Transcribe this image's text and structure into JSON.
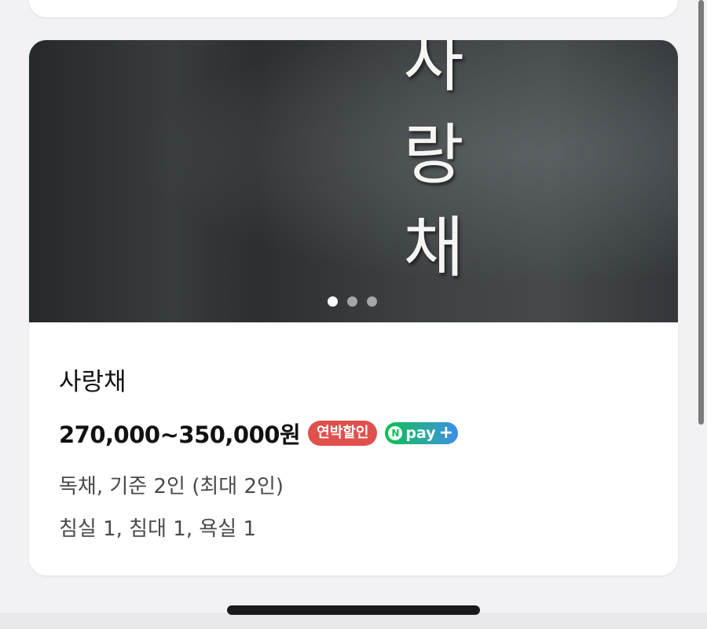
{
  "listing": {
    "photo_sign_chars": [
      "사",
      "랑",
      "채"
    ],
    "carousel": {
      "total": 3,
      "active_index": 0
    },
    "title": "사랑채",
    "price": "270,000~350,000원",
    "badges": {
      "discount": "연박할인",
      "npay_letter": "N",
      "npay_text": "pay",
      "npay_plus": "+"
    },
    "description_line1": "독채, 기준 2인 (최대 2인)",
    "description_line2": "침실 1, 침대 1, 욕실 1"
  },
  "colors": {
    "discount_badge": "#e0504d",
    "npay_green": "#0bbf52",
    "npay_blue": "#3b8fe8"
  }
}
